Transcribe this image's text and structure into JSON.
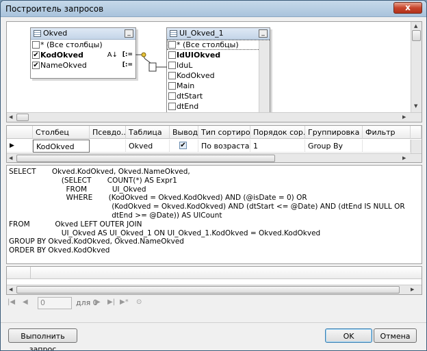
{
  "window": {
    "title": "Построитель запросов",
    "close_label": "x"
  },
  "diagram": {
    "tables": [
      {
        "name": "Okved",
        "columns": [
          {
            "label": "* (Все столбцы)",
            "checked": false,
            "bold": false,
            "sort": "",
            "group": ""
          },
          {
            "label": "KodOkved",
            "checked": true,
            "bold": true,
            "sort": "A↓",
            "group": "[:="
          },
          {
            "label": "NameOkved",
            "checked": true,
            "bold": false,
            "sort": "",
            "group": "[:="
          }
        ]
      },
      {
        "name": "UI_Okved_1",
        "columns": [
          {
            "label": "* (Все столбцы)",
            "checked": false,
            "bold": false
          },
          {
            "label": "IdUIOkved",
            "checked": false,
            "bold": true
          },
          {
            "label": "IduL",
            "checked": false,
            "bold": false
          },
          {
            "label": "KodOkved",
            "checked": false,
            "bold": false
          },
          {
            "label": "Main",
            "checked": false,
            "bold": false
          },
          {
            "label": "dtStart",
            "checked": false,
            "bold": false
          },
          {
            "label": "dtEnd",
            "checked": false,
            "bold": false
          }
        ]
      }
    ]
  },
  "grid": {
    "headers": [
      "Столбец",
      "Псевдо...",
      "Таблица",
      "Вывод",
      "Тип сортиро...",
      "Порядок сор...",
      "Группировка",
      "Фильтр"
    ],
    "row": {
      "column": "KodOkved",
      "alias": "",
      "table": "Okved",
      "output": true,
      "sort_type": "По возраста...",
      "sort_order": "1",
      "grouping": "Group By",
      "filter": ""
    }
  },
  "sql": {
    "lines": [
      "SELECT       Okved.KodOkved, Okved.NameOkved,",
      "                       (SELECT       COUNT(*) AS Expr1",
      "                         FROM           UI_Okved",
      "                         WHERE       (KodOkved = Okved.KodOkved) AND (@isDate = 0) OR",
      "                                             (KodOkved = Okved.KodOkved) AND (dtStart <= @Date) AND (dtEnd IS NULL OR",
      "                                             dtEnd >= @Date)) AS UICount",
      "FROM           Okved LEFT OUTER JOIN",
      "                       UI_Okved AS UI_Okved_1 ON UI_Okved_1.KodOkved = Okved.KodOkved",
      "GROUP BY Okved.KodOkved, Okved.NameOkved",
      "ORDER BY Okved.KodOkved"
    ]
  },
  "navigator": {
    "value": "0",
    "of_label": "для 0"
  },
  "buttons": {
    "execute": "Выполнить запрос",
    "ok": "OK",
    "cancel": "Отмена"
  }
}
